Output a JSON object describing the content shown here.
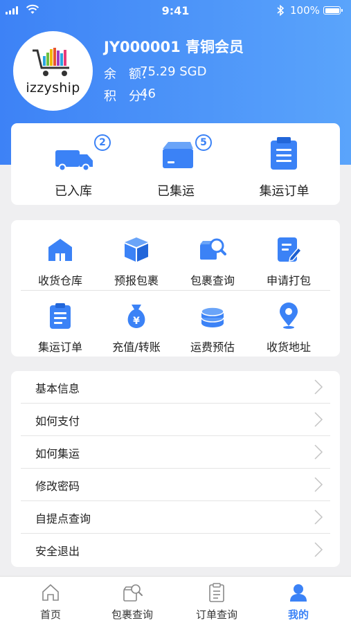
{
  "status_bar": {
    "time": "9:41",
    "battery": "100%"
  },
  "profile": {
    "logo_text": "izzyship",
    "member_line": "JY000001 青铜会员",
    "balance_label": "余　额：",
    "balance_value": "75.29 SGD",
    "points_label": "积　分：",
    "points_value": "46"
  },
  "summary": [
    {
      "label": "已入库",
      "badge": "2",
      "icon": "truck-icon"
    },
    {
      "label": "已集运",
      "badge": "5",
      "icon": "box-icon"
    },
    {
      "label": "集运订单",
      "icon": "clipboard-icon"
    }
  ],
  "features": [
    {
      "label": "收货仓库",
      "icon": "warehouse-icon"
    },
    {
      "label": "预报包裹",
      "icon": "package-icon"
    },
    {
      "label": "包裹查询",
      "icon": "package-search-icon"
    },
    {
      "label": "申请打包",
      "icon": "edit-document-icon"
    },
    {
      "label": "集运订单",
      "icon": "clipboard-icon"
    },
    {
      "label": "充值/转账",
      "icon": "money-bag-icon"
    },
    {
      "label": "运费预估",
      "icon": "coin-stack-icon"
    },
    {
      "label": "收货地址",
      "icon": "location-pin-icon"
    }
  ],
  "menu": [
    {
      "label": "基本信息"
    },
    {
      "label": "如何支付"
    },
    {
      "label": "如何集运"
    },
    {
      "label": "修改密码"
    },
    {
      "label": "自提点查询"
    },
    {
      "label": "安全退出"
    }
  ],
  "tabs": [
    {
      "label": "首页",
      "icon": "home-icon",
      "active": false
    },
    {
      "label": "包裹查询",
      "icon": "package-search-icon",
      "active": false
    },
    {
      "label": "订单查询",
      "icon": "order-list-icon",
      "active": false
    },
    {
      "label": "我的",
      "icon": "user-icon",
      "active": true
    }
  ],
  "colors": {
    "primary": "#3b82f6",
    "gradient_end": "#5aa4fb",
    "background": "#efeff1"
  }
}
